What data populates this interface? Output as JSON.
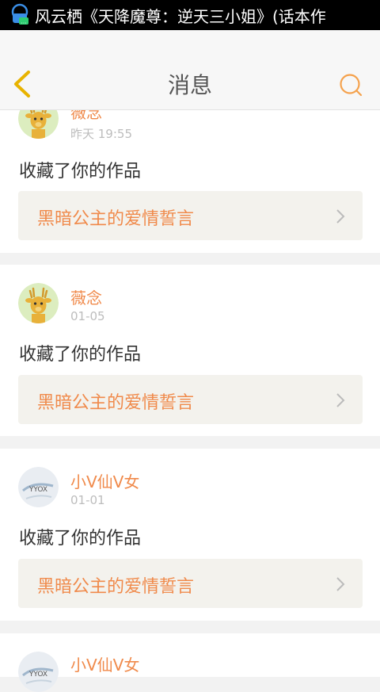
{
  "status_bar": {
    "notification_text": "风云栖《天降魔尊：逆天三小姐》(话本作"
  },
  "header": {
    "title": "消息",
    "back_icon": "chevron-left-icon",
    "search_icon": "search-icon"
  },
  "messages": [
    {
      "user": "薇念",
      "time": "昨天 19:55",
      "action": "收藏了你的作品",
      "work_title": "黑暗公主的爱情誓言",
      "avatar": "deer-avatar"
    },
    {
      "user": "薇念",
      "time": "01-05",
      "action": "收藏了你的作品",
      "work_title": "黑暗公主的爱情誓言",
      "avatar": "deer-avatar"
    },
    {
      "user": "小V仙V女",
      "time": "01-01",
      "action": "收藏了你的作品",
      "work_title": "黑暗公主的爱情誓言",
      "avatar": "sketch-avatar"
    },
    {
      "user": "小V仙V女",
      "time": "",
      "action": "",
      "work_title": "",
      "avatar": "sketch-avatar"
    }
  ],
  "colors": {
    "accent": "#f08a4b",
    "back_icon": "#e8b300",
    "card_bg": "#ffffff",
    "page_bg": "#f2f2f2"
  }
}
